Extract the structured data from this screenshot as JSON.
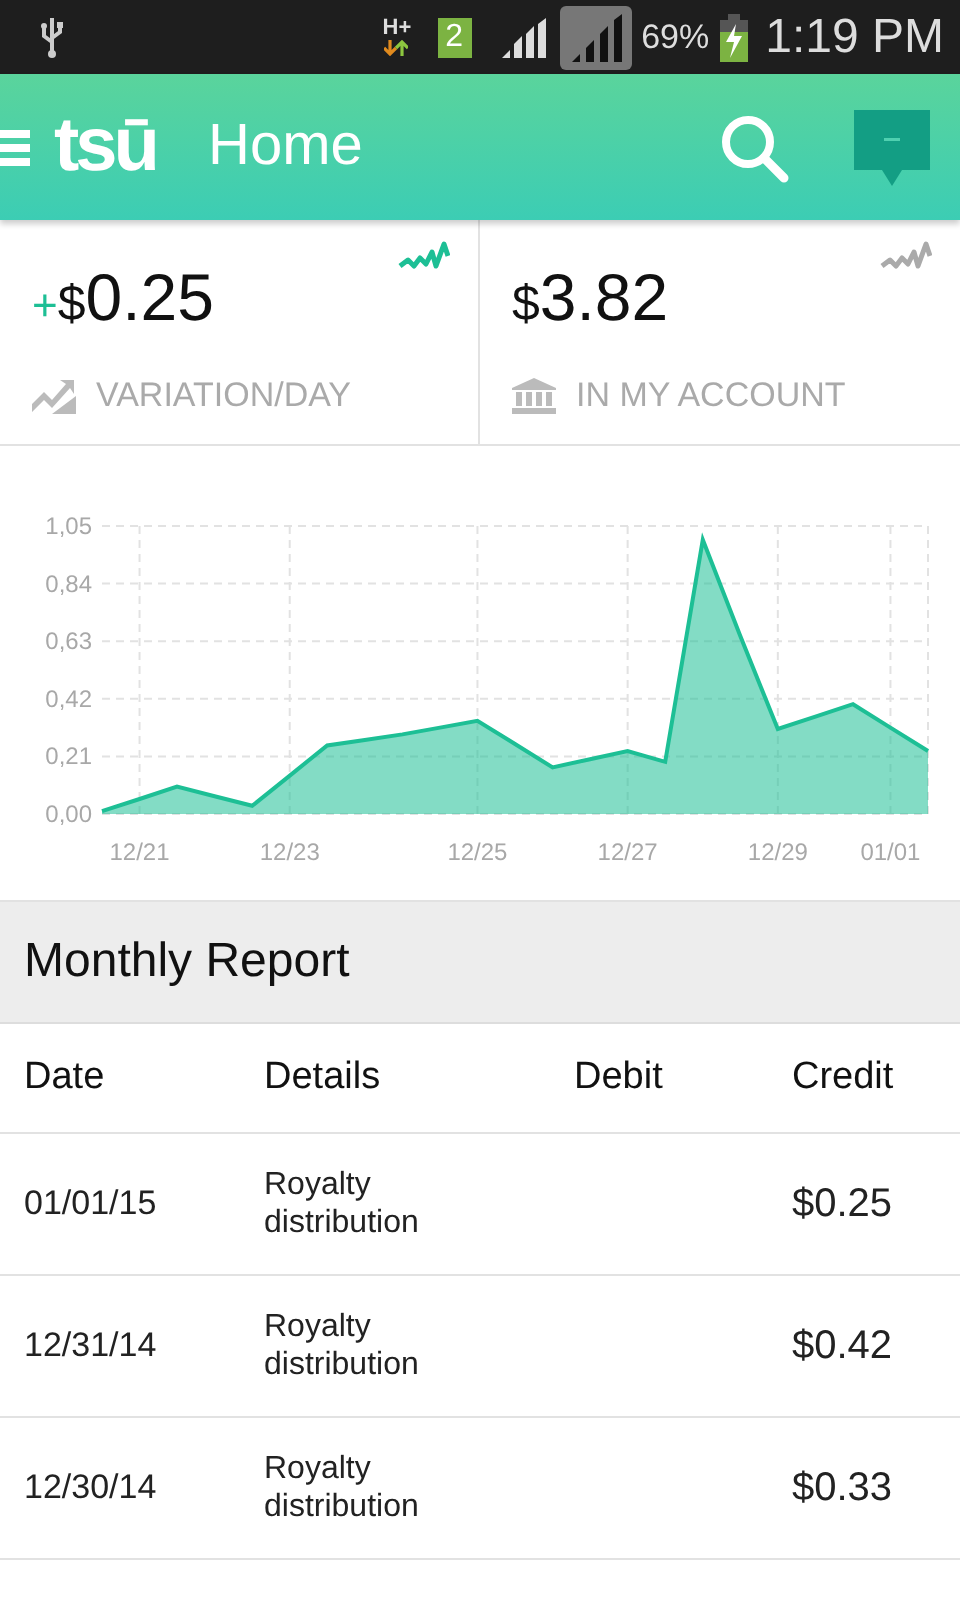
{
  "status_bar": {
    "network": "H+",
    "sim": "2",
    "battery": "69%",
    "time": "1:19 PM"
  },
  "app_bar": {
    "logo": "tsū",
    "title": "Home"
  },
  "stats": [
    {
      "prefix": "+",
      "currency": "$",
      "amount": "0.25",
      "label": "VARIATION/DAY",
      "kind": "variation",
      "active": true
    },
    {
      "currency": "$",
      "amount": "3.82",
      "label": "IN MY ACCOUNT",
      "kind": "account",
      "active": false
    }
  ],
  "chart": {
    "chart_data": {
      "type": "area",
      "grid": true,
      "categories": [
        null,
        "12/21",
        null,
        null,
        null,
        "12/23",
        null,
        null,
        null,
        null,
        "12/25",
        null,
        null,
        null,
        "12/27",
        null,
        null,
        null,
        "12/29",
        null,
        null,
        "01/01",
        null
      ],
      "series": [
        {
          "color": "#1dbf95",
          "values": [
            0.01,
            0.055,
            0.1,
            0.065,
            0.03,
            0.14,
            0.25,
            0.27,
            0.29,
            0.315,
            0.34,
            0.255,
            0.17,
            0.2,
            0.23,
            0.19,
            1.0,
            0.65,
            0.31,
            0.355,
            0.4,
            0.315,
            0.23
          ]
        }
      ],
      "ylim": [
        0,
        1.05
      ],
      "yticks": [
        {
          "value": 0,
          "label": "0,00"
        },
        {
          "value": 0.21,
          "label": "0,21"
        },
        {
          "value": 0.42,
          "label": "0,42"
        },
        {
          "value": 0.63,
          "label": "0,63"
        },
        {
          "value": 0.84,
          "label": "0,84"
        },
        {
          "value": 1.05,
          "label": "1,05"
        }
      ]
    }
  },
  "report": {
    "title": "Monthly Report",
    "columns": [
      "Date",
      "Details",
      "Debit",
      "Credit"
    ],
    "rows": [
      {
        "date": "01/01/15",
        "details": "Royalty distribution",
        "credit": "$0.25"
      },
      {
        "date": "12/31/14",
        "details": "Royalty distribution",
        "credit": "$0.42"
      },
      {
        "date": "12/30/14",
        "details": "Royalty distribution",
        "credit": "$0.33"
      }
    ]
  }
}
